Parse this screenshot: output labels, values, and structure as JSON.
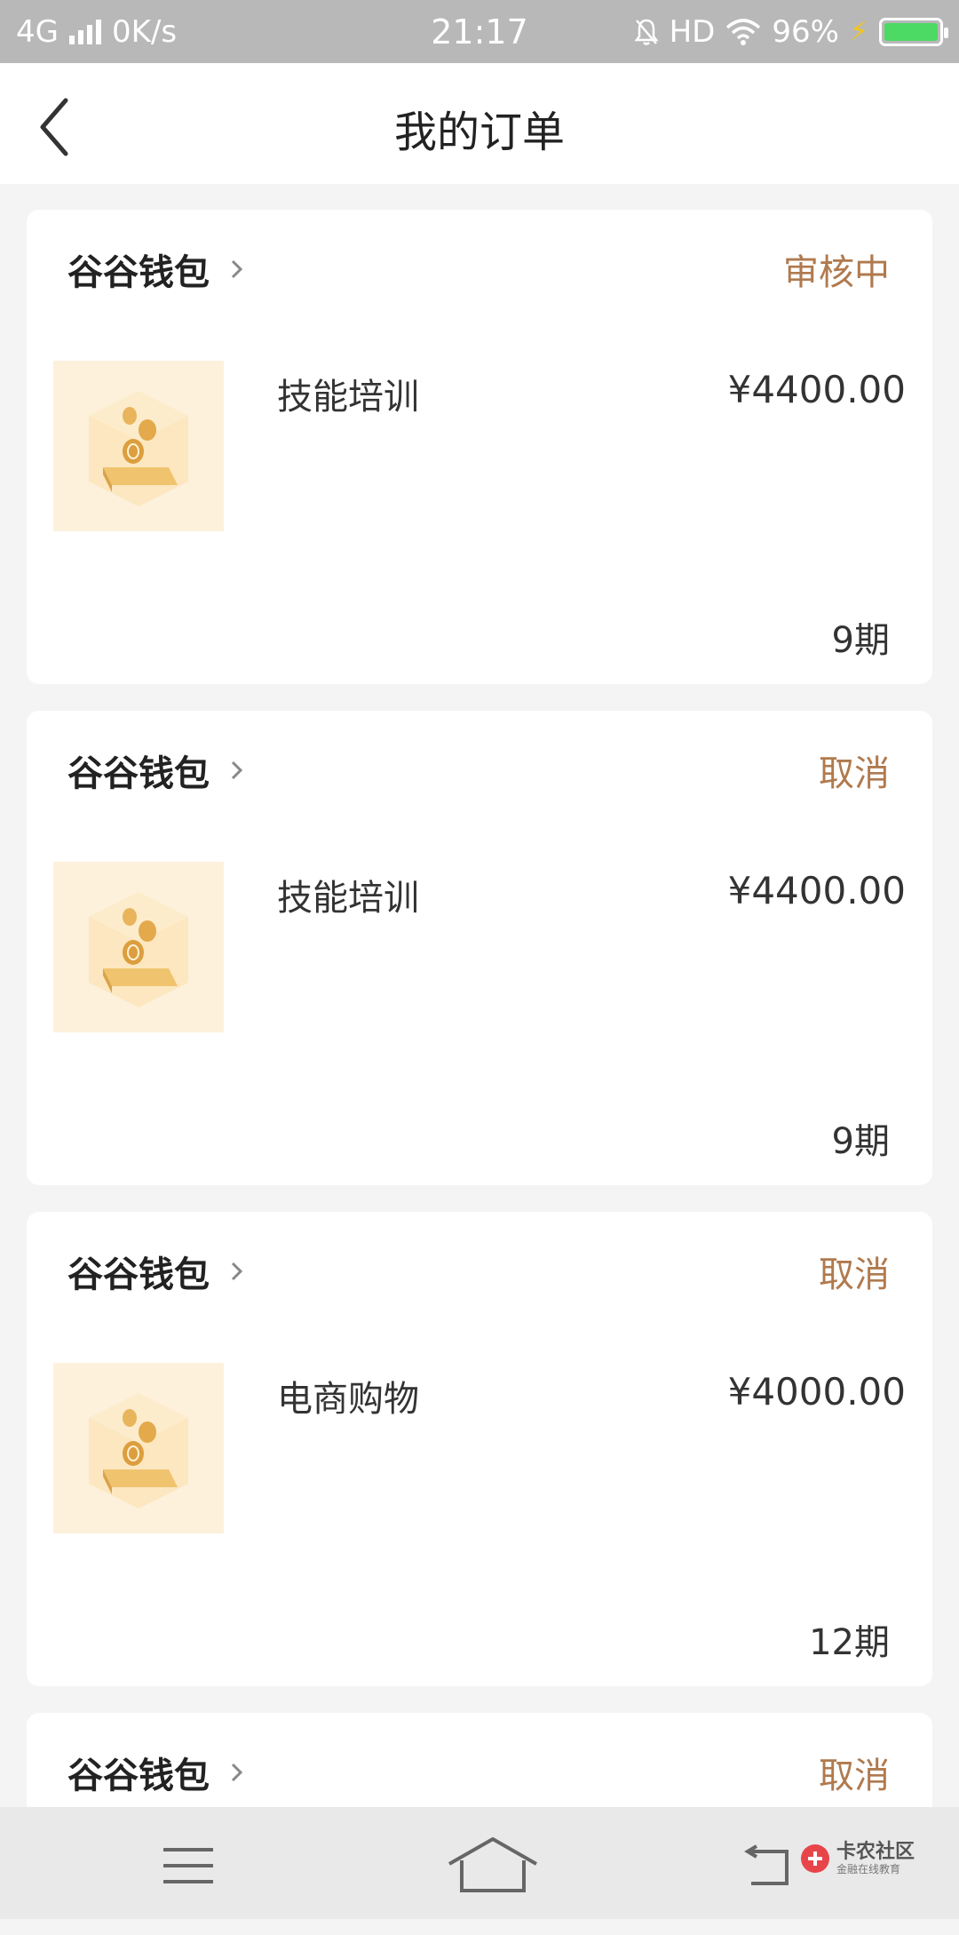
{
  "status_bar": {
    "network": "4G",
    "speed": "0K/s",
    "time": "21:17",
    "hd": "HD",
    "battery": "96%"
  },
  "header": {
    "title": "我的订单"
  },
  "orders": [
    {
      "merchant": "谷谷钱包",
      "status": "审核中",
      "product": "技能培训",
      "price": "¥4400.00",
      "period": "9期"
    },
    {
      "merchant": "谷谷钱包",
      "status": "取消",
      "product": "技能培训",
      "price": "¥4400.00",
      "period": "9期"
    },
    {
      "merchant": "谷谷钱包",
      "status": "取消",
      "product": "电商购物",
      "price": "¥4000.00",
      "period": "12期"
    },
    {
      "merchant": "谷谷钱包",
      "status": "取消"
    }
  ],
  "watermark": {
    "main": "卡农社区",
    "sub": "金融在线教育"
  },
  "colors": {
    "status_accent": "#b07a4e",
    "battery": "#4cd964",
    "statusbar_bg": "#b8b8b8"
  }
}
